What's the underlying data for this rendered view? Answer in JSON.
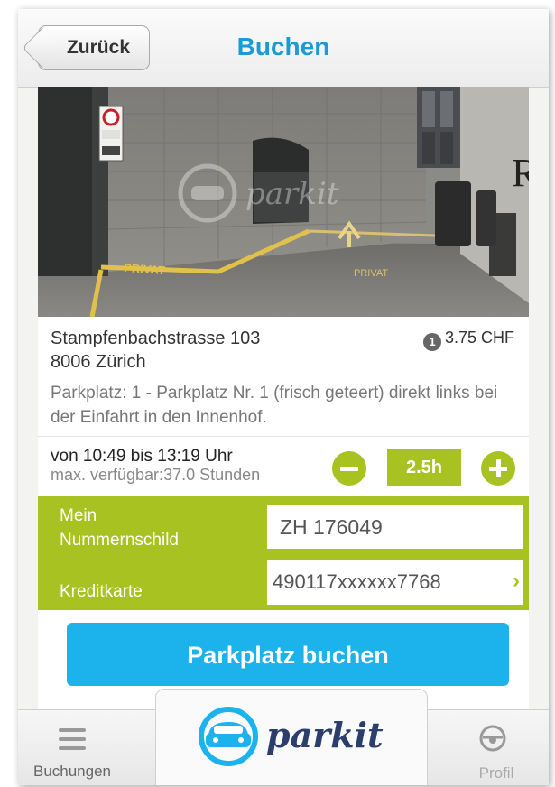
{
  "nav": {
    "back_label": "Zurück",
    "title": "Buchen"
  },
  "listing": {
    "street": "Stampfenbachstrasse 103",
    "city": "8006 Zürich",
    "price": "3.75 CHF",
    "price_icon": "coin-icon",
    "description": "Parkplatz: 1 - Parkplatz Nr. 1 (frisch geteert) direkt links bei der Einfahrt in den Innenhof.",
    "photo_signs": {
      "privat_left": "PRIVAT",
      "privat_right": "PRIVAT",
      "watermark": "parkit"
    }
  },
  "time": {
    "range": "von 10:49 bis 13:19 Uhr",
    "max_available_label": "max. verfügbar:",
    "max_available_value": "37.0 Stunden",
    "duration": "2.5h"
  },
  "form": {
    "plate_label": "Mein Nummernschild",
    "plate_value": "ZH 176049",
    "card_label": "Kreditkarte",
    "card_value": "490117xxxxxx7768"
  },
  "book_label": "Parkplatz buchen",
  "tabbar": {
    "left_label": "Buchungen",
    "logo_text": "parkit",
    "right_label": "Profil"
  },
  "colors": {
    "accent_green": "#a8c222",
    "brand_blue": "#1cb3ec",
    "title_blue": "#1a9bd6"
  }
}
